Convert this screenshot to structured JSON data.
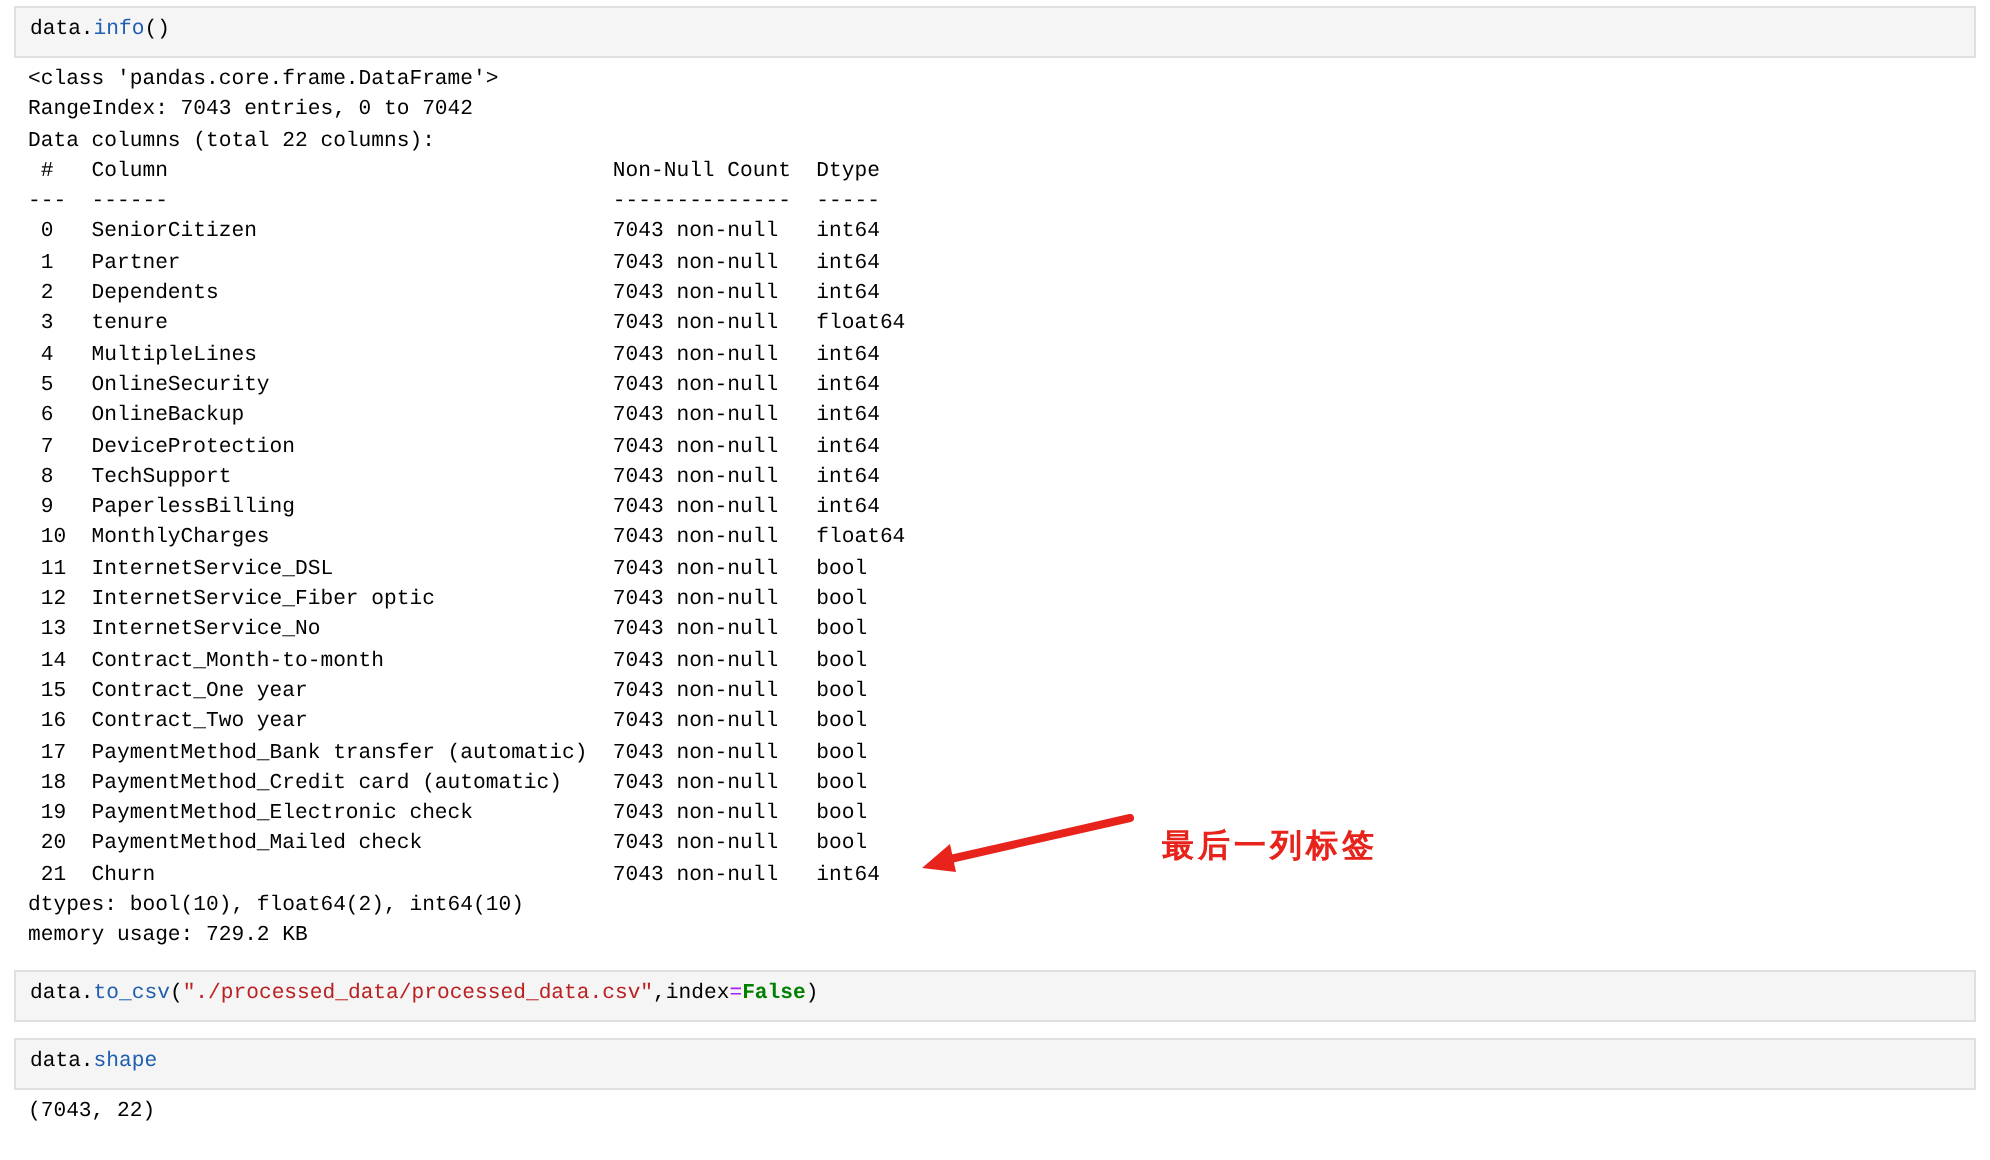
{
  "cells": [
    {
      "input": [
        {
          "text": "data.",
          "kind": "plain"
        },
        {
          "text": "info",
          "kind": "attr"
        },
        {
          "text": "()",
          "kind": "plain"
        }
      ],
      "output": {
        "lines": [
          {
            "kind": "text",
            "text": "<class 'pandas.core.frame.DataFrame'>"
          },
          {
            "kind": "text",
            "text": "RangeIndex: 7043 entries, 0 to 7042"
          },
          {
            "kind": "text",
            "text": "Data columns (total 22 columns):"
          },
          {
            "kind": "row",
            "index": "#",
            "column": "Column",
            "count": "Non-Null Count",
            "dtype": "Dtype"
          },
          {
            "kind": "text",
            "text": "---  ------                                   --------------  -----"
          },
          {
            "kind": "row",
            "index": "0",
            "column": "SeniorCitizen",
            "count": "7043 non-null",
            "dtype": "int64"
          },
          {
            "kind": "row",
            "index": "1",
            "column": "Partner",
            "count": "7043 non-null",
            "dtype": "int64"
          },
          {
            "kind": "row",
            "index": "2",
            "column": "Dependents",
            "count": "7043 non-null",
            "dtype": "int64"
          },
          {
            "kind": "row",
            "index": "3",
            "column": "tenure",
            "count": "7043 non-null",
            "dtype": "float64"
          },
          {
            "kind": "row",
            "index": "4",
            "column": "MultipleLines",
            "count": "7043 non-null",
            "dtype": "int64"
          },
          {
            "kind": "row",
            "index": "5",
            "column": "OnlineSecurity",
            "count": "7043 non-null",
            "dtype": "int64"
          },
          {
            "kind": "row",
            "index": "6",
            "column": "OnlineBackup",
            "count": "7043 non-null",
            "dtype": "int64"
          },
          {
            "kind": "row",
            "index": "7",
            "column": "DeviceProtection",
            "count": "7043 non-null",
            "dtype": "int64"
          },
          {
            "kind": "row",
            "index": "8",
            "column": "TechSupport",
            "count": "7043 non-null",
            "dtype": "int64"
          },
          {
            "kind": "row",
            "index": "9",
            "column": "PaperlessBilling",
            "count": "7043 non-null",
            "dtype": "int64"
          },
          {
            "kind": "row",
            "index": "10",
            "column": "MonthlyCharges",
            "count": "7043 non-null",
            "dtype": "float64"
          },
          {
            "kind": "row",
            "index": "11",
            "column": "InternetService_DSL",
            "count": "7043 non-null",
            "dtype": "bool"
          },
          {
            "kind": "row",
            "index": "12",
            "column": "InternetService_Fiber optic",
            "count": "7043 non-null",
            "dtype": "bool"
          },
          {
            "kind": "row",
            "index": "13",
            "column": "InternetService_No",
            "count": "7043 non-null",
            "dtype": "bool"
          },
          {
            "kind": "row",
            "index": "14",
            "column": "Contract_Month-to-month",
            "count": "7043 non-null",
            "dtype": "bool"
          },
          {
            "kind": "row",
            "index": "15",
            "column": "Contract_One year",
            "count": "7043 non-null",
            "dtype": "bool"
          },
          {
            "kind": "row",
            "index": "16",
            "column": "Contract_Two year",
            "count": "7043 non-null",
            "dtype": "bool"
          },
          {
            "kind": "row",
            "index": "17",
            "column": "PaymentMethod_Bank transfer (automatic)",
            "count": "7043 non-null",
            "dtype": "bool"
          },
          {
            "kind": "row",
            "index": "18",
            "column": "PaymentMethod_Credit card (automatic)",
            "count": "7043 non-null",
            "dtype": "bool"
          },
          {
            "kind": "row",
            "index": "19",
            "column": "PaymentMethod_Electronic check",
            "count": "7043 non-null",
            "dtype": "bool"
          },
          {
            "kind": "row",
            "index": "20",
            "column": "PaymentMethod_Mailed check",
            "count": "7043 non-null",
            "dtype": "bool"
          },
          {
            "kind": "row",
            "index": "21",
            "column": "Churn",
            "count": "7043 non-null",
            "dtype": "int64"
          },
          {
            "kind": "text",
            "text": "dtypes: bool(10), float64(2), int64(10)"
          },
          {
            "kind": "text",
            "text": "memory usage: 729.2 KB"
          }
        ],
        "annotation": "最后一列标签"
      }
    },
    {
      "input": [
        {
          "text": "data.",
          "kind": "plain"
        },
        {
          "text": "to_csv",
          "kind": "attr"
        },
        {
          "text": "(",
          "kind": "plain"
        },
        {
          "text": "\"./processed_data/processed_data.csv\"",
          "kind": "string"
        },
        {
          "text": ",index",
          "kind": "plain"
        },
        {
          "text": "=",
          "kind": "operator"
        },
        {
          "text": "False",
          "kind": "keyword"
        },
        {
          "text": ")",
          "kind": "plain"
        }
      ]
    },
    {
      "input": [
        {
          "text": "data.",
          "kind": "plain"
        },
        {
          "text": "shape",
          "kind": "attr"
        }
      ],
      "output": {
        "lines": [
          {
            "kind": "text",
            "text": "(7043, 22)"
          }
        ]
      }
    }
  ]
}
